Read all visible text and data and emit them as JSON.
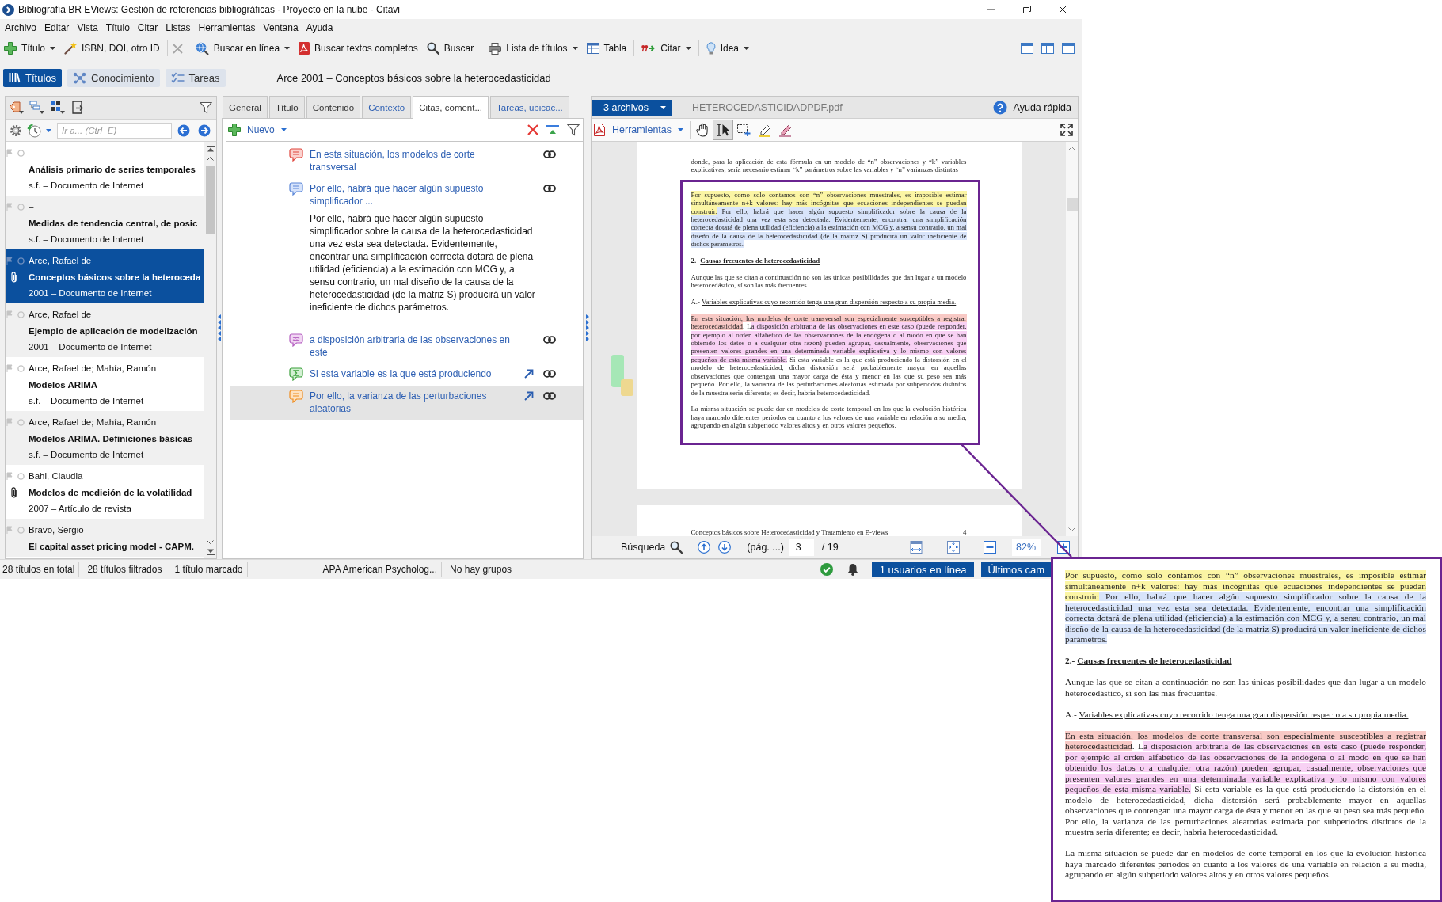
{
  "window": {
    "title": "Bibliografía BR EViews: Gestión de referencias bibliográficas - Proyecto en la nube - Citavi"
  },
  "menu": [
    "Archivo",
    "Editar",
    "Vista",
    "Título",
    "Citar",
    "Listas",
    "Herramientas",
    "Ventana",
    "Ayuda"
  ],
  "toolbar": {
    "groups": [
      [
        {
          "label": "Título",
          "dropdown": true,
          "disabled": false
        },
        {
          "label": "ISBN, DOI, otro ID",
          "dropdown": false,
          "disabled": false
        }
      ],
      [
        {
          "dropdown": false,
          "disabled": true
        }
      ],
      [
        {
          "label": "Buscar en línea",
          "dropdown": true,
          "disabled": false
        },
        {
          "label": "Buscar textos completos",
          "dropdown": false,
          "disabled": false
        },
        {
          "label": "Buscar",
          "dropdown": false,
          "disabled": false
        }
      ],
      [
        {
          "label": "Lista de títulos",
          "dropdown": true,
          "disabled": false
        },
        {
          "label": "Tabla",
          "dropdown": false,
          "disabled": false
        }
      ],
      [
        {
          "label": "Citar",
          "dropdown": true,
          "disabled": false
        }
      ],
      [
        {
          "label": "Idea",
          "dropdown": true,
          "disabled": false
        }
      ]
    ]
  },
  "nav": {
    "tabs": [
      {
        "label": "Títulos",
        "selected": true
      },
      {
        "label": "Conocimiento",
        "selected": false
      },
      {
        "label": "Tareas",
        "selected": false
      }
    ],
    "heading": "Arce 2001 – Conceptos básicos sobre la heterocedasticidad"
  },
  "references": {
    "go_to": {
      "placeholder": "Ir a... (Ctrl+E)"
    },
    "items": [
      {
        "author": "–",
        "title": "Análisis primario de series temporales",
        "info": "s.f. – Documento de Internet",
        "attachment": false,
        "selected": false
      },
      {
        "author": "–",
        "title": "Medidas de tendencia central, de posic",
        "info": "s.f. – Documento de Internet",
        "attachment": false,
        "selected": false
      },
      {
        "author": "Arce, Rafael de",
        "title": "Conceptos básicos sobre la heteroceda",
        "info": "2001 – Documento de Internet",
        "attachment": true,
        "selected": true
      },
      {
        "author": "Arce, Rafael de",
        "title": "Ejemplo de aplicación de modelización",
        "info": "2001 – Documento de Internet",
        "attachment": false,
        "selected": false
      },
      {
        "author": "Arce, Rafael de; Mahía, Ramón",
        "title": "Modelos ARIMA",
        "info": "s.f. – Documento de Internet",
        "attachment": false,
        "selected": false
      },
      {
        "author": "Arce, Rafael de; Mahía, Ramón",
        "title": "Modelos ARIMA. Definiciones básicas",
        "info": "s.f. – Documento de Internet",
        "attachment": false,
        "selected": false
      },
      {
        "author": "Bahi, Claudia",
        "title": "Modelos de medición de la volatilidad",
        "info": "2007 – Artículo de revista",
        "attachment": true,
        "selected": false
      },
      {
        "author": "Bravo, Sergio",
        "title": "El capital asset pricing model - CAPM.",
        "attachment": false,
        "selected": false
      }
    ]
  },
  "details": {
    "tabs": [
      {
        "label": "General",
        "selected": false,
        "has_data": false
      },
      {
        "label": "Título",
        "selected": false,
        "has_data": false
      },
      {
        "label": "Contenido",
        "selected": false,
        "has_data": false
      },
      {
        "label": "Contexto",
        "selected": false,
        "has_data": true
      },
      {
        "label": "Citas, coment...",
        "selected": true,
        "has_data": false
      },
      {
        "label": "Tareas, ubicac...",
        "selected": false,
        "has_data": true
      }
    ],
    "new_button": "Nuevo",
    "items": [
      {
        "kind": "quotation",
        "text": "En esta situación, los modelos de corte transversal",
        "arrow": false,
        "selected": false
      },
      {
        "kind": "indirect_quotation",
        "text": "Por ello, habrá que hacer algún supuesto simplificador ...",
        "arrow": false,
        "selected": false,
        "body": "Por ello, habrá que hacer algún supuesto simplificador sobre la causa de la heterocedasticidad una vez esta sea detectada. Evidentemente, encontrar una simplificación correcta dotará de plena utilidad (eficiencia) a la estimación con MCG y, a sensu contrario, un mal diseño de la causa de la heterocedasticidad (de la matriz S) producirá un valor ineficiente de dichos parámetros."
      },
      {
        "kind": "paraphrase",
        "text": "a disposición arbitraria de las observaciones en este",
        "arrow": false,
        "selected": false
      },
      {
        "kind": "summary",
        "text": "Si esta variable es la que está produciendo",
        "arrow": true,
        "selected": false
      },
      {
        "kind": "comment",
        "text": "Por ello, la varianza de las perturbaciones aleatorias",
        "arrow": true,
        "selected": true
      }
    ]
  },
  "pdf_viewer": {
    "files_button": "3 archivos",
    "file_name": "HETEROCEDASTICIDADPDF.pdf",
    "help": "Ayuda rápida",
    "tools_menu": "Herramientas",
    "tools": [
      {
        "selected": false
      },
      {
        "selected": true
      },
      {
        "selected": false
      },
      {
        "selected": false
      },
      {
        "selected": false
      }
    ],
    "page": {
      "paragraphs": [
        {
          "kind": "body",
          "segments": [
            {
              "kind": "plain",
              "text": "donde, para la aplicación de esta fórmula en un modelo de “n” observaciones y “k” variables explicativas, sería necesario estimar “k” parámetros sobre las variables y “n” varianzas distintas"
            }
          ]
        }
      ],
      "selection_frame": {
        "paragraphs": [
          {
            "kind": "body",
            "segments": [
              {
                "kind": "highlight",
                "color": "#fbf5a4",
                "text": "Por supuesto, como solo contamos con “n” observaciones muestrales, es imposible estimar simultáneamente n+k valores: hay más incógnitas que ecuaciones independientes se puedan construir."
              },
              {
                "kind": "highlight",
                "color": "#d8e4fa",
                "text": " Por ello, habrá que hacer algún supuesto simplificador sobre la causa de la heterocedasticidad una vez esta sea detectada. Evidentemente, encontrar una simplificación correcta dotará de plena utilidad (eficiencia) a la estimación con MCG y, a sensu contrario, un mal diseño de la causa de la heterocedasticidad (de la matriz S) producirá un valor ineficiente de dichos parámetros."
              }
            ]
          },
          {
            "kind": "heading",
            "segments": [
              {
                "kind": "plain",
                "text": "2.- "
              },
              {
                "kind": "underline",
                "text": "Causas frecuentes de heterocedasticidad"
              }
            ]
          },
          {
            "kind": "body",
            "segments": [
              {
                "kind": "plain",
                "text": "Aunque las que se citan a continuación no son las únicas posibilidades que dan lugar a un modelo heterocedástico, sí son las más frecuentes."
              }
            ]
          },
          {
            "kind": "body",
            "segments": [
              {
                "kind": "plain",
                "text": "A.- "
              },
              {
                "kind": "underline",
                "text": "Variables explicativas cuyo recorrido tenga una gran dispersión respecto a su propia media."
              }
            ]
          },
          {
            "kind": "body",
            "segments": [
              {
                "kind": "highlight",
                "color": "#f8c9c5",
                "text": "En esta situación, los modelos de corte transversal son especialmente susceptibles a registrar heterocedasticidad"
              },
              {
                "kind": "plain",
                "text": ". L"
              },
              {
                "kind": "highlight",
                "color": "#f8d1f4",
                "text": "a disposición arbitraria de las observaciones en este caso (puede responder, por ejemplo al orden alfabético de las observaciones de la endógena o al modo en que se han obtenido los datos o a cualquier otra razón) pueden agrupar, casualmente, observaciones que presenten valores grandes en una determinada variable explicativa y lo mismo con valores pequeños de esta misma variable."
              },
              {
                "kind": "plain",
                "text": " Si esta variable es la que está produciendo la distorsión en el modelo de heterocedasticidad, dicha distorsión será probablemente mayor en aquellas observaciones que contengan una mayor carga de ésta y menor en las que su peso sea más pequeño. Por ello, la varianza de las perturbaciones aleatorias estimada por subperiodos distintos de la muestra seria diferente; es decir, habria heterocedasticidad."
              }
            ]
          },
          {
            "kind": "body",
            "segments": [
              {
                "kind": "plain",
                "text": "La misma situación se puede dar en modelos de corte temporal en los que la evolución histórica haya marcado diferentes periodos en cuanto a los valores de una variable en relación a su media, agrupando en algún subperiodo valores altos y en otros valores pequeños."
              }
            ]
          }
        ]
      }
    },
    "margin_markers": [
      {
        "color": "#a6e7b6"
      },
      {
        "color": "#eed890"
      }
    ],
    "next_page": {
      "header": "Conceptos básicos sobre Heterocedasticidad y Tratamiento en E-views",
      "number": "4"
    },
    "footer": {
      "search_label": "Búsqueda",
      "page_hint": "(pág. ...)",
      "page": "3",
      "page_total": "/ 19",
      "zoom": "82%"
    }
  },
  "status_bar": {
    "cells": [
      "28 títulos en total",
      "28 títulos filtrados",
      "1 título marcado",
      "APA American Psycholog...",
      "No hay grupos"
    ],
    "online_button": "1 usuarios en línea",
    "recent_button": "Últimos cam"
  },
  "magnifier": {
    "paragraphs": [
      {
        "kind": "body",
        "segments": [
          {
            "kind": "highlight",
            "color": "#fbf5a4",
            "text": "Por supuesto, como solo contamos con “n” observaciones muestrales, es imposible estimar simultáneamente n+k valores: hay más incógnitas que ecuaciones independientes se puedan construir."
          },
          {
            "kind": "highlight",
            "color": "#d8e4fa",
            "text": " Por ello, habrá que hacer algún supuesto simplificador sobre la causa de la heterocedasticidad una vez esta sea detectada. Evidentemente, encontrar una simplificación correcta dotará de plena utilidad (eficiencia) a la estimación con MCG y, a sensu contrario, un mal diseño de la causa de la heterocedasticidad (de la matriz S) producirá un valor ineficiente de dichos parámetros."
          }
        ]
      },
      {
        "kind": "heading",
        "segments": [
          {
            "kind": "plain",
            "text": "2.- "
          },
          {
            "kind": "underline",
            "text": "Causas frecuentes de heterocedasticidad"
          }
        ]
      },
      {
        "kind": "body",
        "segments": [
          {
            "kind": "plain",
            "text": "Aunque las que se citan a continuación no son las únicas posibilidades que dan lugar a un modelo heterocedástico, sí son las más frecuentes."
          }
        ]
      },
      {
        "kind": "body",
        "segments": [
          {
            "kind": "plain",
            "text": "A.- "
          },
          {
            "kind": "underline",
            "text": "Variables explicativas cuyo recorrido tenga una gran dispersión respecto a su propia media."
          }
        ]
      },
      {
        "kind": "body",
        "segments": [
          {
            "kind": "highlight",
            "color": "#f8c9c5",
            "text": "En esta situación, los modelos de corte transversal son especialmente susceptibles a registrar heterocedasticidad"
          },
          {
            "kind": "plain",
            "text": ". L"
          },
          {
            "kind": "highlight",
            "color": "#f8d1f4",
            "text": "a disposición arbitraria de las observaciones en este caso (puede responder, por ejemplo al orden alfabético de las observaciones de la endógena o al modo en que se han obtenido los datos o a cualquier otra razón) pueden agrupar, casualmente, observaciones que presenten valores grandes en una determinada variable explicativa y lo mismo con valores pequeños de esta misma variable."
          },
          {
            "kind": "plain",
            "text": " Si esta variable es la que está produciendo la distorsión en el modelo de heterocedasticidad, dicha distorsión será probablemente mayor en aquellas observaciones que contengan una mayor carga de ésta y menor en las que su peso sea más pequeño. Por ello, la varianza de las perturbaciones aleatorias estimada por subperiodos distintos de la muestra seria diferente; es decir, habria heterocedasticidad."
          }
        ]
      },
      {
        "kind": "body",
        "segments": [
          {
            "kind": "plain",
            "text": "La misma situación se puede dar en modelos de corte temporal en los que la evolución histórica haya marcado diferentes periodos en cuanto a los valores de una variable en relación a su media, agrupando en algún subperiodo valores altos y en otros valores pequeños."
          }
        ]
      }
    ]
  }
}
